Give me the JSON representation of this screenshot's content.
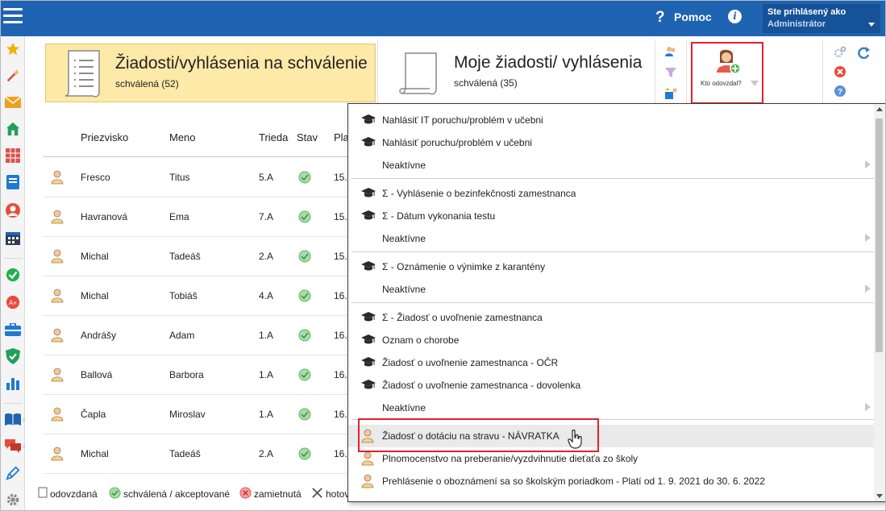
{
  "header": {
    "help_label": "Pomoc",
    "user_line1": "Ste prihlásený ako",
    "user_line2": "Administrátor"
  },
  "cards": {
    "approval_title": "Žiadosti/vyhlásenia na schválenie",
    "approval_sub": "schválená (52)",
    "mine_title": "Moje žiadosti/ vyhlásenia",
    "mine_sub": "schválená (35)"
  },
  "who_submitted": {
    "label": "Kto odovzdal?"
  },
  "table": {
    "headers": [
      "Priezvisko",
      "Meno",
      "Trieda",
      "Stav",
      "Pla"
    ],
    "rows": [
      {
        "surname": "Fresco",
        "name": "Titus",
        "class": "5.A",
        "date": "15."
      },
      {
        "surname": "Havranová",
        "name": "Ema",
        "class": "7.A",
        "date": "15."
      },
      {
        "surname": "Michal",
        "name": "Tadeáš",
        "class": "2.A",
        "date": "15."
      },
      {
        "surname": "Michal",
        "name": "Tobiáš",
        "class": "4.A",
        "date": "16."
      },
      {
        "surname": "Andrášy",
        "name": "Adam",
        "class": "1.A",
        "date": "16."
      },
      {
        "surname": "Ballová",
        "name": "Barbora",
        "class": "1.A",
        "date": "16."
      },
      {
        "surname": "Čapla",
        "name": "Miroslav",
        "class": "1.A",
        "date": "16."
      },
      {
        "surname": "Michal",
        "name": "Tadeáš",
        "class": "2.A",
        "date": "16."
      }
    ]
  },
  "legend": {
    "submitted": "odovzdaná",
    "approved": "schválená / akceptované",
    "rejected": "zamietnutá",
    "done": "hotov"
  },
  "dropdown": {
    "items": [
      {
        "label": "Nahlásiť IT poruchu/problém v učebni",
        "icon": "graduation-cap-icon"
      },
      {
        "label": "Nahlásiť poruchu/problém v učebni",
        "icon": "graduation-cap-icon"
      },
      {
        "label": "Neaktívne",
        "icon": "",
        "submenu": true
      },
      {
        "label": "Σ - Vyhlásenie o bezinfekčnosti zamestnanca",
        "icon": "graduation-cap-icon"
      },
      {
        "label": "Σ - Dátum vykonania testu",
        "icon": "graduation-cap-icon"
      },
      {
        "label": "Neaktívne",
        "icon": "",
        "submenu": true
      },
      {
        "label": "Σ - Oznámenie o výnimke z karantény",
        "icon": "graduation-cap-icon"
      },
      {
        "label": "Neaktívne",
        "icon": "",
        "submenu": true
      },
      {
        "label": "Σ - Žiadosť o uvoľnenie zamestnanca",
        "icon": "graduation-cap-icon"
      },
      {
        "label": "Oznam o chorobe",
        "icon": "graduation-cap-icon"
      },
      {
        "label": "Žiadosť o uvoľnenie zamestnanca - OČR",
        "icon": "graduation-cap-icon"
      },
      {
        "label": "Žiadosť o uvoľnenie zamestnanca - dovolenka",
        "icon": "graduation-cap-icon"
      },
      {
        "label": "Neaktívne",
        "icon": "",
        "submenu": true
      },
      {
        "label": "Žiadosť o dotáciu na stravu - NÁVRATKA",
        "icon": "person-icon"
      },
      {
        "label": "Plnomocenstvo na preberanie/vyzdvihnutie dieťaťa zo školy",
        "icon": "person-icon"
      },
      {
        "label": "Prehlásenie o oboznámení sa so školským poriadkom - Platí od 1. 9. 2021 do 30. 6. 2022",
        "icon": "person-icon"
      }
    ]
  },
  "colors": {
    "topbar": "#1f64b3",
    "card_highlight": "#fde9a8",
    "annotation_red": "#e3202d",
    "approved_green": "#5cb85c"
  }
}
